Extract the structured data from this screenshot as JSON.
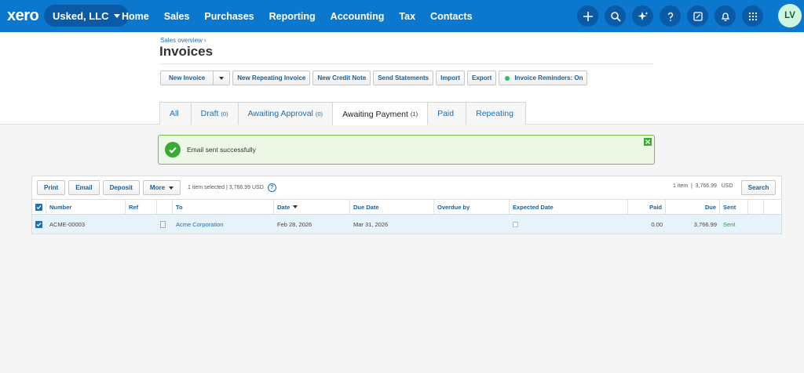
{
  "app": {
    "logo": "xero",
    "org": "Usked, LLC",
    "avatar": "LV"
  },
  "nav": {
    "links": [
      "Home",
      "Sales",
      "Purchases",
      "Reporting",
      "Accounting",
      "Tax",
      "Contacts"
    ]
  },
  "nav_icons": [
    "plus-icon",
    "search-icon",
    "sparkle-icon",
    "help-icon",
    "notes-icon",
    "bell-icon",
    "apps-grid-icon"
  ],
  "page": {
    "breadcrumb": "Sales overview ›",
    "title": "Invoices"
  },
  "toolbar": {
    "new_invoice": "New Invoice",
    "new_repeating": "New Repeating Invoice",
    "new_credit": "New Credit Note",
    "send_statements": "Send Statements",
    "import": "Import",
    "export": "Export",
    "reminders": "Invoice Reminders: On"
  },
  "tabs": [
    {
      "label": "All",
      "count": ""
    },
    {
      "label": "Draft",
      "count": "(0)"
    },
    {
      "label": "Awaiting Approval",
      "count": "(0)"
    },
    {
      "label": "Awaiting Payment",
      "count": "(1)"
    },
    {
      "label": "Paid",
      "count": ""
    },
    {
      "label": "Repeating",
      "count": ""
    }
  ],
  "alert": {
    "message": "Email sent successfully"
  },
  "list": {
    "buttons": {
      "print": "Print",
      "email": "Email",
      "deposit": "Deposit",
      "more": "More"
    },
    "selection_info": "1 item selected | 3,766.99 USD",
    "total_info": "1 item  |  3,766.99   USD",
    "search": "Search"
  },
  "table": {
    "headers": {
      "number": "Number",
      "ref": "Ref",
      "to": "To",
      "date": "Date",
      "due_date": "Due Date",
      "overdue_by": "Overdue by",
      "expected_date": "Expected Date",
      "paid": "Paid",
      "due": "Due",
      "sent": "Sent"
    },
    "rows": [
      {
        "number": "ACME-00003",
        "ref": "",
        "to": "Acme Corporation",
        "date": "Feb 28, 2026",
        "due_date": "Mar 31, 2026",
        "overdue_by": "",
        "expected_date": "",
        "paid": "0.00",
        "due": "3,766.99",
        "sent": "Sent"
      }
    ]
  },
  "colors": {
    "nav": "#0b78ce",
    "accent": "#1b6fb6",
    "success_border": "#68c13f",
    "success": "#3aaa35"
  }
}
